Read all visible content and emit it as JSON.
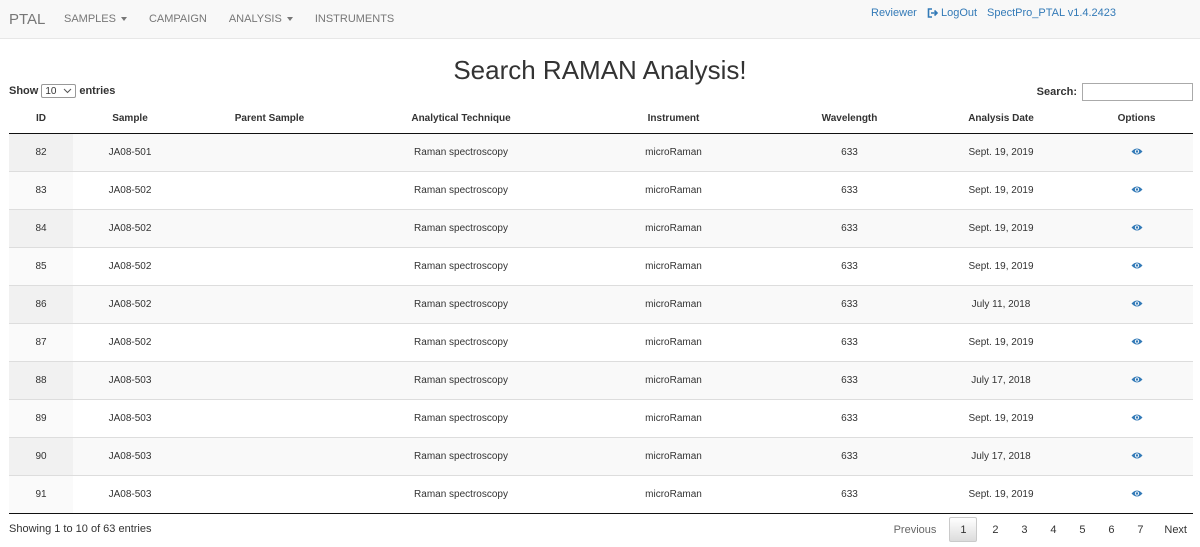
{
  "navbar": {
    "brand": "PTAL",
    "menu": [
      {
        "label": "SAMPLES",
        "dropdown": true
      },
      {
        "label": "CAMPAIGN",
        "dropdown": false
      },
      {
        "label": "ANALYSIS",
        "dropdown": true
      },
      {
        "label": "INSTRUMENTS",
        "dropdown": false
      }
    ],
    "user": "Reviewer",
    "logout": "LogOut",
    "version": "SpectPro_PTAL v1.4.2423"
  },
  "page": {
    "title": "Search RAMAN Analysis!"
  },
  "length": {
    "before": "Show",
    "value": "10",
    "after": "entries"
  },
  "search": {
    "label": "Search:",
    "value": ""
  },
  "table": {
    "columns": [
      "ID",
      "Sample",
      "Parent Sample",
      "Analytical Technique",
      "Instrument",
      "Wavelength",
      "Analysis Date",
      "Options"
    ],
    "rows": [
      [
        "82",
        "JA08-501",
        "",
        "Raman spectroscopy",
        "microRaman",
        "633",
        "Sept. 19, 2019"
      ],
      [
        "83",
        "JA08-502",
        "",
        "Raman spectroscopy",
        "microRaman",
        "633",
        "Sept. 19, 2019"
      ],
      [
        "84",
        "JA08-502",
        "",
        "Raman spectroscopy",
        "microRaman",
        "633",
        "Sept. 19, 2019"
      ],
      [
        "85",
        "JA08-502",
        "",
        "Raman spectroscopy",
        "microRaman",
        "633",
        "Sept. 19, 2019"
      ],
      [
        "86",
        "JA08-502",
        "",
        "Raman spectroscopy",
        "microRaman",
        "633",
        "July 11, 2018"
      ],
      [
        "87",
        "JA08-502",
        "",
        "Raman spectroscopy",
        "microRaman",
        "633",
        "Sept. 19, 2019"
      ],
      [
        "88",
        "JA08-503",
        "",
        "Raman spectroscopy",
        "microRaman",
        "633",
        "July 17, 2018"
      ],
      [
        "89",
        "JA08-503",
        "",
        "Raman spectroscopy",
        "microRaman",
        "633",
        "Sept. 19, 2019"
      ],
      [
        "90",
        "JA08-503",
        "",
        "Raman spectroscopy",
        "microRaman",
        "633",
        "July 17, 2018"
      ],
      [
        "91",
        "JA08-503",
        "",
        "Raman spectroscopy",
        "microRaman",
        "633",
        "Sept. 19, 2019"
      ]
    ],
    "option_icon": "eye-icon"
  },
  "footer": {
    "info": "Showing 1 to 10 of 63 entries",
    "previous": "Previous",
    "pages": [
      "1",
      "2",
      "3",
      "4",
      "5",
      "6",
      "7"
    ],
    "current_page": "1",
    "next": "Next"
  },
  "colors": {
    "link": "#337ab7",
    "navbar_bg": "#f8f8f8",
    "stripe": "#f9f9f9"
  }
}
